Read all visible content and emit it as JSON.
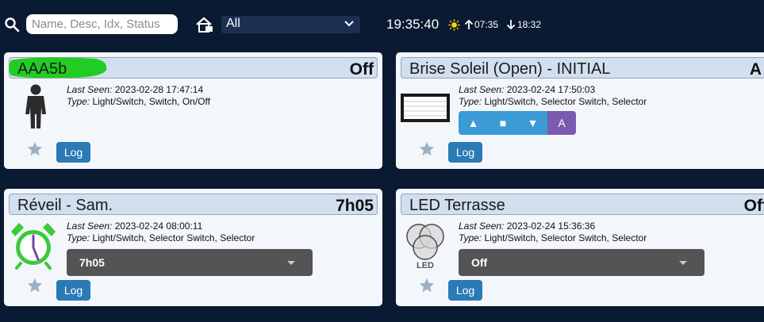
{
  "toolbar": {
    "search_placeholder": "Name, Desc, Idx, Status",
    "room_select": "All",
    "clock": "19:35:40",
    "sunrise": "07:35",
    "sunset": "18:32"
  },
  "labels": {
    "last_seen": "Last Seen:",
    "type": "Type:",
    "log": "Log"
  },
  "devices": [
    {
      "name": "AAA5b",
      "status": "Off",
      "last_seen": "2023-02-28 17:47:14",
      "type": "Light/Switch, Switch, On/Off",
      "icon": "person-icon",
      "highlight_color": "#22cc22"
    },
    {
      "name": "Brise Soleil (Open) - INITIAL",
      "status": "A",
      "last_seen": "2023-02-24 17:50:03",
      "type": "Light/Switch, Selector Switch, Selector",
      "icon": "blinds-icon",
      "selector_buttons": [
        "▲",
        "■",
        "▼",
        "A"
      ]
    },
    {
      "name": "Réveil - Sam.",
      "status": "7h05",
      "last_seen": "2023-02-24 08:00:11",
      "type": "Light/Switch, Selector Switch, Selector",
      "icon": "alarm-clock-icon",
      "dropdown_value": "7h05"
    },
    {
      "name": "LED Terrasse",
      "status": "Off",
      "last_seen": "2023-02-24 15:36:36",
      "type": "Light/Switch, Selector Switch, Selector",
      "icon": "led-rgb-icon",
      "dropdown_value": "Off"
    }
  ],
  "colors": {
    "background": "#0b1a33",
    "card": "#f3f6fb",
    "header": "#d1dfef",
    "log_button": "#2a7ab5",
    "selector_blue": "#3a9bd6",
    "selector_active": "#7b5bb0",
    "dropdown": "#545454"
  }
}
